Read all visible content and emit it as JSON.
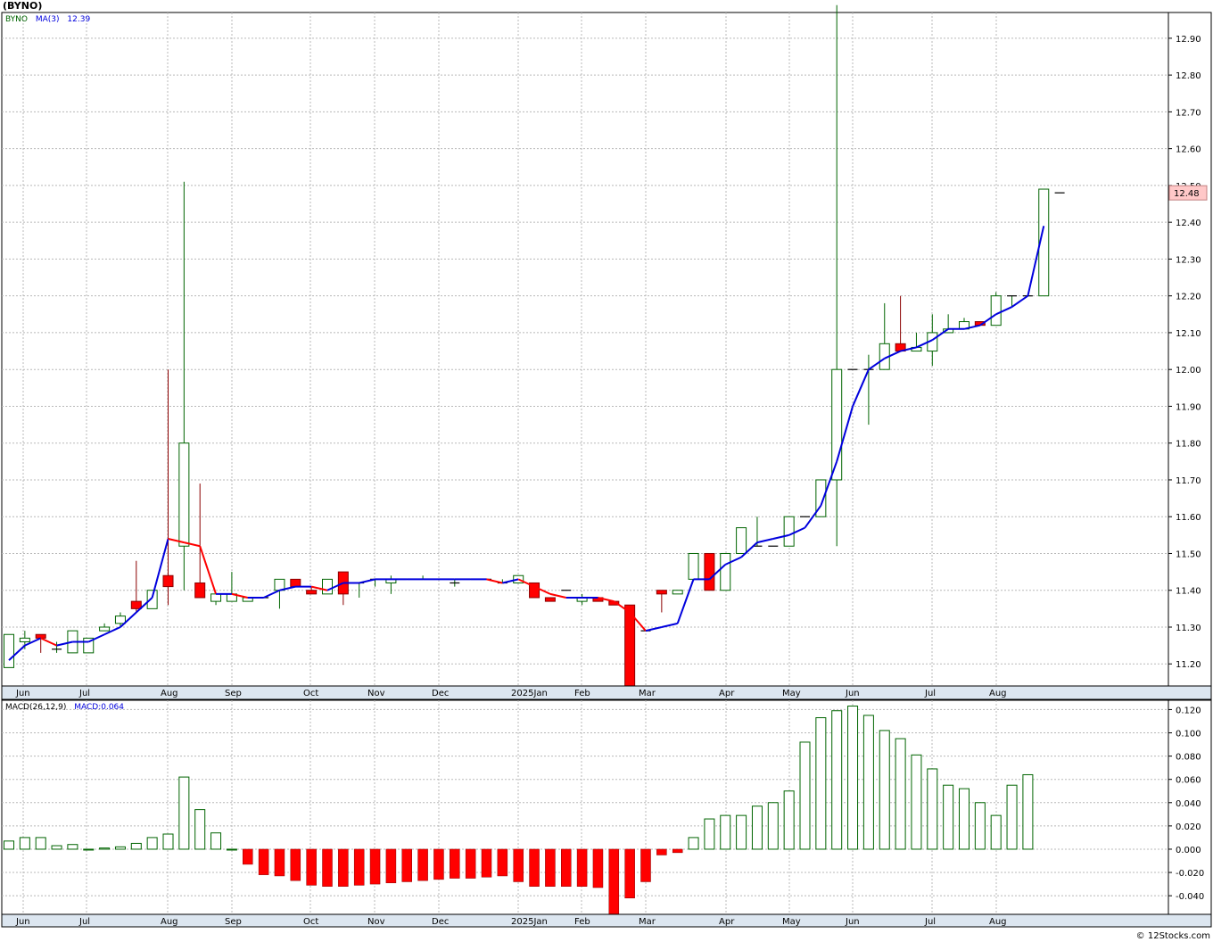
{
  "title": "(BYNO)",
  "watermark": "© 12Stocks.com",
  "colors": {
    "up": "#006400",
    "down": "#ff0000",
    "ma_up": "#0000dd",
    "ma_down": "#ff0000",
    "grid": "#b8b8b8",
    "axis_band": "#dce6f0",
    "price_tag": "#ffc8c8"
  },
  "chart_data": [
    {
      "type": "candlestick",
      "legend": {
        "symbol": "BYNO",
        "ma_label": "MA(3)",
        "ma_value": "12.39"
      },
      "current_price": "12.48",
      "ylim": [
        11.14,
        12.97
      ],
      "yticks": [
        "11.20",
        "11.30",
        "11.40",
        "11.50",
        "11.60",
        "11.70",
        "11.80",
        "11.90",
        "12.00",
        "12.10",
        "12.20",
        "12.30",
        "12.40",
        "12.50",
        "12.60",
        "12.70",
        "12.80",
        "12.90"
      ],
      "x_months": [
        "Jun",
        "Jul",
        "Aug",
        "Sep",
        "Oct",
        "Nov",
        "Dec",
        "2025Jan",
        "Feb",
        "Mar",
        "Apr",
        "May",
        "Jun",
        "Jul",
        "Aug"
      ],
      "candles": [
        {
          "o": 11.19,
          "h": 11.28,
          "l": 11.19,
          "c": 11.28
        },
        {
          "o": 11.26,
          "h": 11.29,
          "l": 11.24,
          "c": 11.27
        },
        {
          "o": 11.28,
          "h": 11.28,
          "l": 11.23,
          "c": 11.27
        },
        {
          "o": 11.24,
          "h": 11.26,
          "l": 11.23,
          "c": 11.24
        },
        {
          "o": 11.23,
          "h": 11.29,
          "l": 11.23,
          "c": 11.29
        },
        {
          "o": 11.23,
          "h": 11.27,
          "l": 11.23,
          "c": 11.27
        },
        {
          "o": 11.29,
          "h": 11.31,
          "l": 11.29,
          "c": 11.3
        },
        {
          "o": 11.31,
          "h": 11.34,
          "l": 11.3,
          "c": 11.33
        },
        {
          "o": 11.37,
          "h": 11.48,
          "l": 11.34,
          "c": 11.35
        },
        {
          "o": 11.35,
          "h": 11.4,
          "l": 11.35,
          "c": 11.4
        },
        {
          "o": 11.44,
          "h": 12.0,
          "l": 11.36,
          "c": 11.41
        },
        {
          "o": 11.52,
          "h": 12.51,
          "l": 11.4,
          "c": 11.8
        },
        {
          "o": 11.42,
          "h": 11.69,
          "l": 11.38,
          "c": 11.38
        },
        {
          "o": 11.37,
          "h": 11.39,
          "l": 11.36,
          "c": 11.39
        },
        {
          "o": 11.37,
          "h": 11.45,
          "l": 11.37,
          "c": 11.39
        },
        {
          "o": 11.37,
          "h": 11.38,
          "l": 11.37,
          "c": 11.38
        },
        {
          "o": 11.38,
          "h": 11.38,
          "l": 11.38,
          "c": 11.38
        },
        {
          "o": 11.4,
          "h": 11.41,
          "l": 11.35,
          "c": 11.43
        },
        {
          "o": 11.43,
          "h": 11.43,
          "l": 11.41,
          "c": 11.41
        },
        {
          "o": 11.4,
          "h": 11.41,
          "l": 11.39,
          "c": 11.39
        },
        {
          "o": 11.39,
          "h": 11.43,
          "l": 11.39,
          "c": 11.43
        },
        {
          "o": 11.45,
          "h": 11.45,
          "l": 11.36,
          "c": 11.39
        },
        {
          "o": 11.42,
          "h": 11.42,
          "l": 11.38,
          "c": 11.42
        },
        {
          "o": 11.43,
          "h": 11.43,
          "l": 11.41,
          "c": 11.43
        },
        {
          "o": 11.42,
          "h": 11.44,
          "l": 11.39,
          "c": 11.43
        },
        {
          "o": 11.43,
          "h": 11.43,
          "l": 11.43,
          "c": 11.43
        },
        {
          "o": 11.43,
          "h": 11.44,
          "l": 11.43,
          "c": 11.43
        },
        {
          "o": 11.43,
          "h": 11.43,
          "l": 11.43,
          "c": 11.43
        },
        {
          "o": 11.42,
          "h": 11.43,
          "l": 11.41,
          "c": 11.42
        },
        {
          "o": 11.43,
          "h": 11.43,
          "l": 11.43,
          "c": 11.43
        },
        {
          "o": 11.43,
          "h": 11.43,
          "l": 11.43,
          "c": 11.43
        },
        {
          "o": 11.42,
          "h": 11.43,
          "l": 11.42,
          "c": 11.42
        },
        {
          "o": 11.42,
          "h": 11.44,
          "l": 11.42,
          "c": 11.44
        },
        {
          "o": 11.42,
          "h": 11.42,
          "l": 11.38,
          "c": 11.38
        },
        {
          "o": 11.38,
          "h": 11.38,
          "l": 11.37,
          "c": 11.37
        },
        {
          "o": 11.4,
          "h": 11.4,
          "l": 11.4,
          "c": 11.4
        },
        {
          "o": 11.37,
          "h": 11.39,
          "l": 11.36,
          "c": 11.38
        },
        {
          "o": 11.38,
          "h": 11.38,
          "l": 11.37,
          "c": 11.37
        },
        {
          "o": 11.37,
          "h": 11.37,
          "l": 11.36,
          "c": 11.36
        },
        {
          "o": 11.36,
          "h": 11.13,
          "l": 11.13,
          "c": 11.13
        },
        {
          "o": 11.29,
          "h": 11.29,
          "l": 11.29,
          "c": 11.29
        },
        {
          "o": 11.4,
          "h": 11.4,
          "l": 11.34,
          "c": 11.39
        },
        {
          "o": 11.39,
          "h": 11.4,
          "l": 11.39,
          "c": 11.4
        },
        {
          "o": 11.43,
          "h": 11.5,
          "l": 11.43,
          "c": 11.5
        },
        {
          "o": 11.5,
          "h": 11.5,
          "l": 11.4,
          "c": 11.4
        },
        {
          "o": 11.4,
          "h": 11.5,
          "l": 11.4,
          "c": 11.5
        },
        {
          "o": 11.5,
          "h": 11.57,
          "l": 11.5,
          "c": 11.57
        },
        {
          "o": 11.52,
          "h": 11.6,
          "l": 11.52,
          "c": 11.52
        },
        {
          "o": 11.52,
          "h": 11.52,
          "l": 11.52,
          "c": 11.52
        },
        {
          "o": 11.52,
          "h": 11.6,
          "l": 11.52,
          "c": 11.6
        },
        {
          "o": 11.6,
          "h": 11.6,
          "l": 11.6,
          "c": 11.6
        },
        {
          "o": 11.6,
          "h": 11.7,
          "l": 11.6,
          "c": 11.7
        },
        {
          "o": 11.7,
          "h": 12.99,
          "l": 11.52,
          "c": 12.0
        },
        {
          "o": 12.0,
          "h": 12.0,
          "l": 12.0,
          "c": 12.0
        },
        {
          "o": 12.0,
          "h": 12.04,
          "l": 11.85,
          "c": 12.0
        },
        {
          "o": 12.0,
          "h": 12.18,
          "l": 12.0,
          "c": 12.07
        },
        {
          "o": 12.07,
          "h": 12.2,
          "l": 12.05,
          "c": 12.05
        },
        {
          "o": 12.05,
          "h": 12.1,
          "l": 12.05,
          "c": 12.06
        },
        {
          "o": 12.05,
          "h": 12.15,
          "l": 12.01,
          "c": 12.1
        },
        {
          "o": 12.1,
          "h": 12.15,
          "l": 12.1,
          "c": 12.11
        },
        {
          "o": 12.11,
          "h": 12.14,
          "l": 12.11,
          "c": 12.13
        },
        {
          "o": 12.13,
          "h": 12.13,
          "l": 12.12,
          "c": 12.12
        },
        {
          "o": 12.12,
          "h": 12.21,
          "l": 12.12,
          "c": 12.2
        },
        {
          "o": 12.2,
          "h": 12.2,
          "l": 12.17,
          "c": 12.2
        },
        {
          "o": 12.2,
          "h": 12.2,
          "l": 12.2,
          "c": 12.2
        },
        {
          "o": 12.2,
          "h": 12.49,
          "l": 12.2,
          "c": 12.49
        },
        {
          "o": 12.48,
          "h": 12.48,
          "l": 12.48,
          "c": 12.48
        }
      ],
      "ma": [
        11.21,
        11.25,
        11.27,
        11.25,
        11.26,
        11.26,
        11.28,
        11.3,
        11.34,
        11.38,
        11.54,
        11.53,
        11.52,
        11.39,
        11.39,
        11.38,
        11.38,
        11.4,
        11.41,
        11.41,
        11.4,
        11.42,
        11.42,
        11.43,
        11.43,
        11.43,
        11.43,
        11.43,
        11.43,
        11.43,
        11.43,
        11.42,
        11.43,
        11.41,
        11.39,
        11.38,
        11.38,
        11.38,
        11.37,
        11.34,
        11.29,
        11.3,
        11.31,
        11.43,
        11.43,
        11.47,
        11.49,
        11.53,
        11.54,
        11.55,
        11.57,
        11.63,
        11.75,
        11.9,
        12.0,
        12.03,
        12.05,
        12.06,
        12.08,
        12.11,
        12.11,
        12.12,
        12.15,
        12.17,
        12.2,
        12.39
      ]
    },
    {
      "type": "bar",
      "legend": {
        "label": "MACD(26,12,9)",
        "value_label": "MACD:0.064"
      },
      "ylim": [
        -0.056,
        0.128
      ],
      "yticks": [
        "-0.040",
        "-0.020",
        "0.000",
        "0.020",
        "0.040",
        "0.060",
        "0.080",
        "0.100",
        "0.120"
      ],
      "x_months": [
        "Jun",
        "Jul",
        "Aug",
        "Sep",
        "Oct",
        "Nov",
        "Dec",
        "2025Jan",
        "Feb",
        "Mar",
        "Apr",
        "May",
        "Jun",
        "Jul",
        "Aug"
      ],
      "values": [
        0.007,
        0.01,
        0.01,
        0.003,
        0.004,
        0.0,
        0.001,
        0.002,
        0.005,
        0.01,
        0.013,
        0.062,
        0.034,
        0.014,
        0.0,
        -0.013,
        -0.022,
        -0.023,
        -0.027,
        -0.031,
        -0.032,
        -0.032,
        -0.031,
        -0.03,
        -0.029,
        -0.028,
        -0.027,
        -0.026,
        -0.025,
        -0.025,
        -0.024,
        -0.023,
        -0.028,
        -0.032,
        -0.032,
        -0.032,
        -0.032,
        -0.033,
        -0.057,
        -0.042,
        -0.028,
        -0.005,
        -0.003,
        0.01,
        0.026,
        0.029,
        0.029,
        0.037,
        0.04,
        0.05,
        0.092,
        0.113,
        0.119,
        0.123,
        0.115,
        0.102,
        0.095,
        0.081,
        0.069,
        0.055,
        0.052,
        0.04,
        0.029,
        0.055,
        0.064
      ]
    }
  ]
}
